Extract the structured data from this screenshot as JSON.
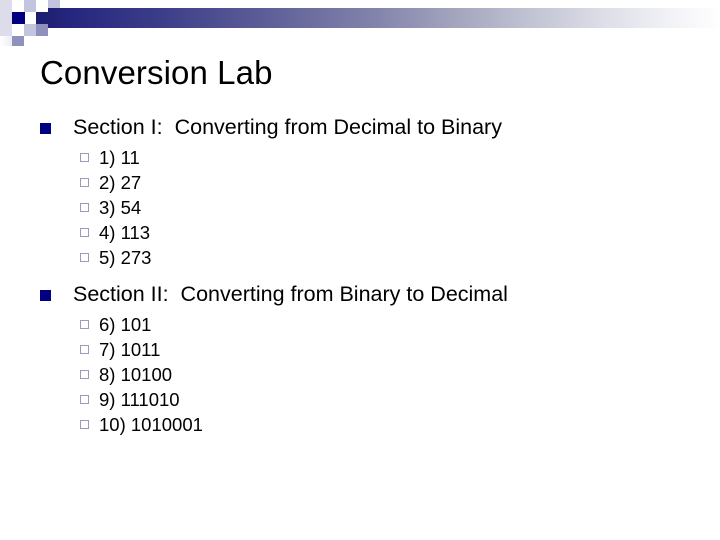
{
  "slide": {
    "title": "Conversion Lab",
    "header": {
      "accent_dark": "#000080",
      "accent_mid": "#8f90bc",
      "accent_light": "#c3c4dd",
      "gradient_start": "#1b1c6e",
      "gradient_end": "#ffffff"
    },
    "bullets": {
      "level1_marker": "filled-square",
      "level1_color": "#000080",
      "level2_marker": "hollow-square",
      "level2_color": "#9a9bbd"
    },
    "sections": [
      {
        "heading": "Section I:  Converting from Decimal to Binary",
        "items": [
          "1) 11",
          "2) 27",
          "3) 54",
          "4) 113",
          "5) 273"
        ]
      },
      {
        "heading": "Section II:  Converting from Binary to Decimal",
        "items": [
          "6) 101",
          "7) 1011",
          "8) 10100",
          "9) 111010",
          "10) 1010001"
        ]
      }
    ]
  }
}
